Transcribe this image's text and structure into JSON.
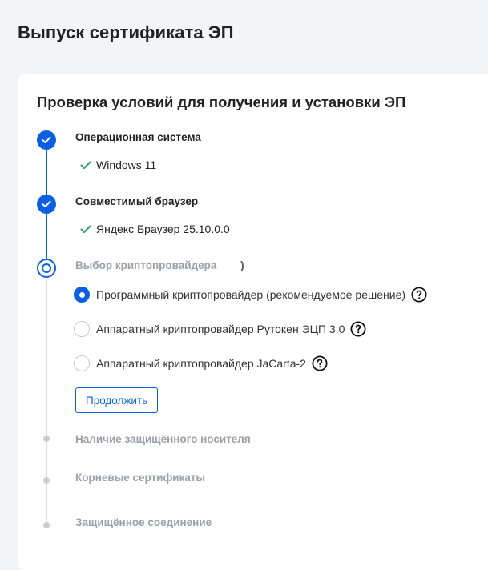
{
  "page": {
    "title": "Выпуск сертификата ЭП"
  },
  "card": {
    "title": "Проверка условий для получения и установки ЭП"
  },
  "steps": [
    {
      "label": "Операционная система",
      "state": "done",
      "result": "Windows 11"
    },
    {
      "label": "Совместимый браузер",
      "state": "done",
      "result": "Яндекс Браузер 25.10.0.0"
    },
    {
      "label": "Выбор криптопровайдера",
      "suffix": ")",
      "state": "current"
    },
    {
      "label": "Наличие защищённого носителя",
      "state": "pending"
    },
    {
      "label": "Корневые сертификаты",
      "state": "pending"
    },
    {
      "label": "Защищённое соединение",
      "state": "pending"
    }
  ],
  "crypto_options": [
    {
      "label": "Программный криптопровайдер (рекомендуемое решение)",
      "checked": true
    },
    {
      "label": "Аппаратный криптопровайдер Рутокен ЭЦП 3.0",
      "checked": false
    },
    {
      "label": "Аппаратный криптопровайдер JaCarta-2",
      "checked": false
    }
  ],
  "continue_button": {
    "label": "Продолжить"
  },
  "colors": {
    "accent": "#0b5fe0",
    "success": "#2e9e5b",
    "muted": "#9aa0a8"
  },
  "icons": {
    "done": "check-icon",
    "result": "checkmark-icon",
    "help": "question-circle-icon"
  }
}
